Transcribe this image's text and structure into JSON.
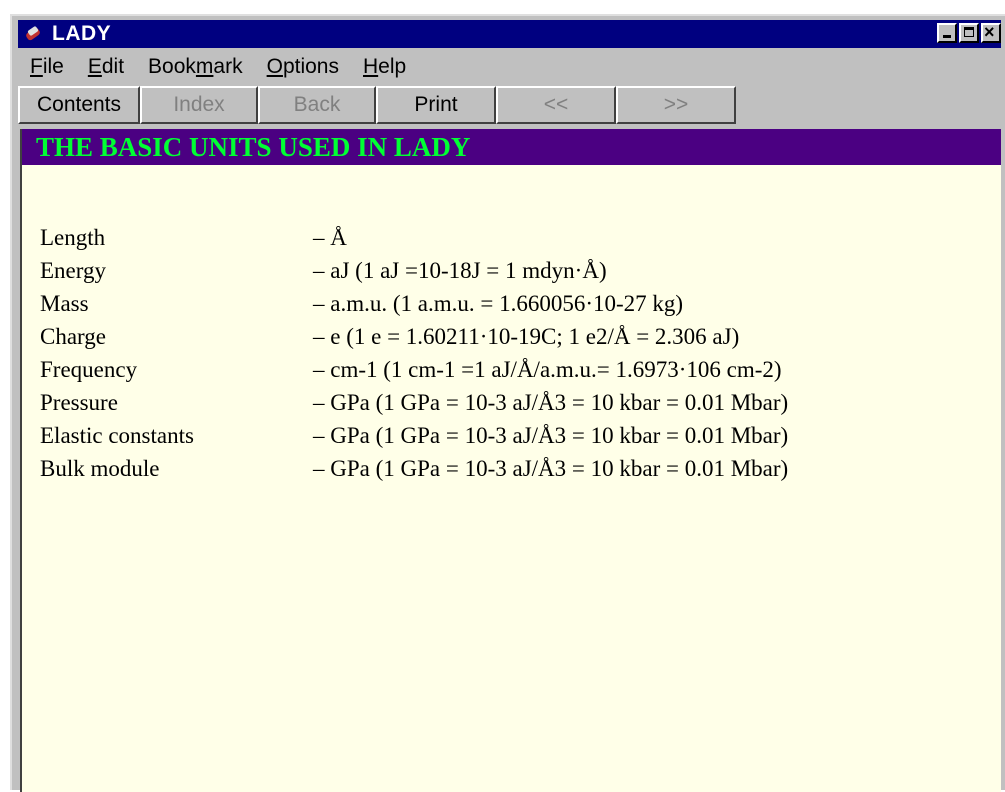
{
  "window": {
    "title": "LADY"
  },
  "menu": [
    {
      "pre": "",
      "ul": "F",
      "post": "ile"
    },
    {
      "pre": "",
      "ul": "E",
      "post": "dit"
    },
    {
      "pre": "Book",
      "ul": "m",
      "post": "ark"
    },
    {
      "pre": "",
      "ul": "O",
      "post": "ptions"
    },
    {
      "pre": "",
      "ul": "H",
      "post": "elp"
    }
  ],
  "toolbar": {
    "contents": "Contents",
    "index": "Index",
    "back": "Back",
    "print": "Print",
    "prev": "<<",
    "next": ">>"
  },
  "heading": "THE BASIC UNITS USED IN LADY",
  "units": [
    {
      "name": "Length",
      "value": "– Å"
    },
    {
      "name": "Energy",
      "value": "– aJ (1 aJ =10-18J = 1 mdyn·Å)"
    },
    {
      "name": "Mass",
      "value": "– a.m.u. (1 a.m.u. = 1.660056·10-27 kg)"
    },
    {
      "name": "Charge",
      "value": "– e (1 e = 1.60211·10-19C; 1 e2/Å = 2.306 aJ)"
    },
    {
      "name": "Frequency",
      "value": "– cm-1 (1 cm-1 =1 aJ/Å/a.m.u.= 1.6973·106 cm-2)"
    },
    {
      "name": "Pressure",
      "value": "– GPa (1 GPa = 10-3 aJ/Å3 = 10 kbar = 0.01 Mbar)"
    },
    {
      "name": "Elastic constants",
      "value": "– GPa (1 GPa = 10-3 aJ/Å3 = 10 kbar = 0.01 Mbar)"
    },
    {
      "name": "Bulk module",
      "value": "– GPa (1 GPa = 10-3 aJ/Å3 = 10 kbar = 0.01 Mbar)"
    }
  ]
}
